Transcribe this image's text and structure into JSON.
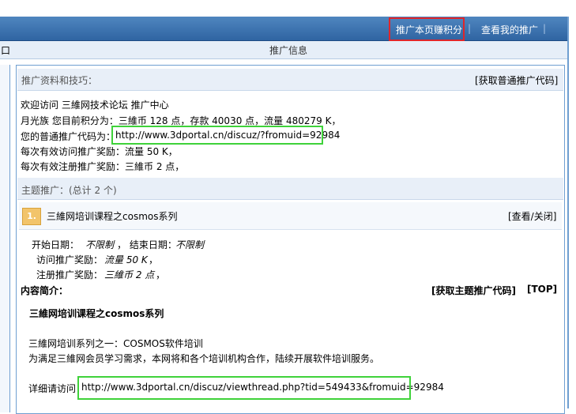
{
  "nav": {
    "link1": "推广本页赚积分",
    "sep1": "|",
    "link2": "查看我的推广",
    "sep2": "|"
  },
  "subheader": {
    "left_char": "口",
    "title": "推广信息"
  },
  "promo": {
    "section_title": "推广资料和技巧：",
    "get_code_link": "[获取普通推广代码]",
    "welcome": "欢迎访问 三維网技术论坛 推广中心",
    "points_line": "月光族 您目前积分为：三維币 128 点，存款 40030 点，流量 480279 K，",
    "code_prefix": "您的普通推广代码为：",
    "code_url": "http://www.3dportal.cn/discuz/?fromuid=92984",
    "visit_reward": "每次有效访问推广奖励：流量 50 K，",
    "register_reward": "每次有效注册推广奖励：三維币 2 点，"
  },
  "topics": {
    "section_title": "主题推广：(总计 2 个)",
    "items": [
      {
        "index": "1.",
        "title": "三維网培训课程之cosmos系列",
        "toggle": "[查看/关闭]",
        "start_label": "开始日期：",
        "start_value": "不限制",
        "end_label": "，  结束日期：",
        "end_value": "不限制",
        "visit_label": "访问推广奖励：",
        "visit_value": "流量 50 K",
        "visit_end": "，",
        "register_label": "注册推广奖励：",
        "register_value": "三維币 2 点",
        "register_end": "，",
        "intro_label": "内容简介：",
        "get_topic_code": "[获取主题推广代码]",
        "top_link": "[TOP]",
        "intro_title": "三維网培训课程之cosmos系列",
        "intro_line1": "三維网培训系列之一：COSMOS软件培训",
        "intro_line2": "为满足三維网会员学习需求，本网将和各个培训机构合作，陆续开展软件培训服务。",
        "detail_label": "详细请访问",
        "detail_url": "http://www.3dportal.cn/discuz/viewthread.php?tid=549433&fromuid=92984"
      }
    ]
  },
  "colors": {
    "nav_bar": "#2f64a2",
    "highlight_red": "#e0262a",
    "highlight_green": "#3fd23a",
    "section_bg": "#e8eff8"
  }
}
